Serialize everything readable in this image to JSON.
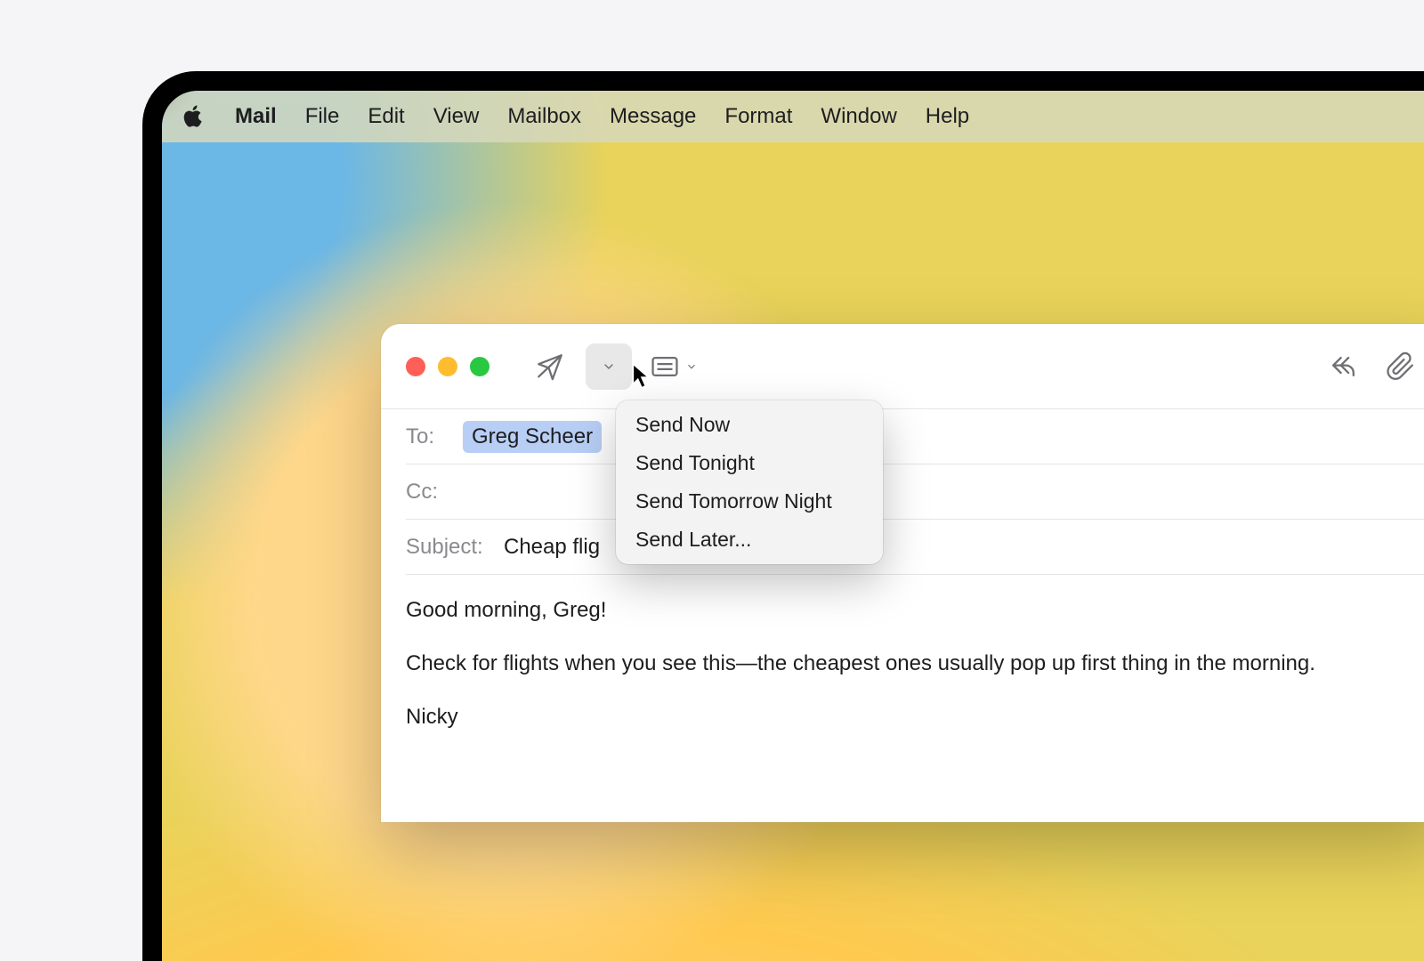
{
  "menubar": {
    "app": "Mail",
    "items": [
      "File",
      "Edit",
      "View",
      "Mailbox",
      "Message",
      "Format",
      "Window",
      "Help"
    ]
  },
  "compose": {
    "to_label": "To:",
    "to_value": "Greg Scheer",
    "cc_label": "Cc:",
    "subject_label": "Subject:",
    "subject_value": "Cheap flig",
    "body_line1": "Good morning, Greg!",
    "body_line2": "Check for flights when you see this—the cheapest ones usually pop up first thing in the morning.",
    "body_signoff": "Nicky"
  },
  "send_menu": {
    "options": [
      "Send Now",
      "Send Tonight",
      "Send Tomorrow Night",
      "Send Later..."
    ]
  },
  "colors": {
    "traffic_red": "#ff5f57",
    "traffic_yellow": "#febc2e",
    "traffic_green": "#28c840"
  }
}
